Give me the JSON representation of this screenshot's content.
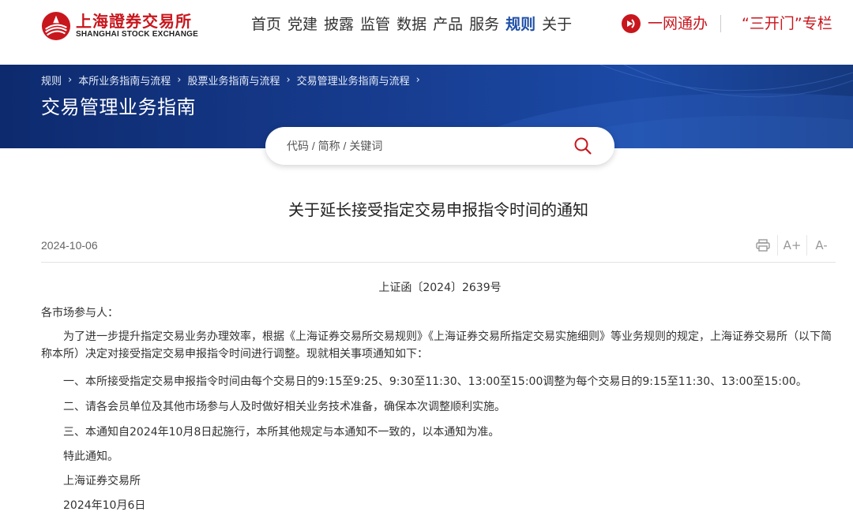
{
  "header": {
    "logo_cn": "上海證券交易所",
    "logo_en": "SHANGHAI STOCK EXCHANGE",
    "nav": [
      "首页",
      "党建",
      "披露",
      "监管",
      "数据",
      "产品",
      "服务",
      "规则",
      "关于"
    ],
    "active_nav": "规则",
    "quick_link_1": "一网通办",
    "quick_link_2": "“三开门”专栏"
  },
  "banner": {
    "breadcrumb": [
      "规则",
      "本所业务指南与流程",
      "股票业务指南与流程",
      "交易管理业务指南与流程"
    ],
    "title": "交易管理业务指南"
  },
  "search": {
    "placeholder": "代码 / 简称 / 关键词"
  },
  "article": {
    "title": "关于延长接受指定交易申报指令时间的通知",
    "date": "2024-10-06",
    "doc_number": "上证函〔2024〕2639号",
    "salutation": "各市场参与人：",
    "paragraph_1": "为了进一步提升指定交易业务办理效率，根据《上海证券交易所交易规则》《上海证券交易所指定交易实施细则》等业务规则的规定，上海证券交易所（以下简称本所）决定对接受指定交易申报指令时间进行调整。现就相关事项通知如下：",
    "item_1": "一、本所接受指定交易申报指令时间由每个交易日的9:15至9:25、9:30至11:30、13:00至15:00调整为每个交易日的9:15至11:30、13:00至15:00。",
    "item_2": "二、请各会员单位及其他市场参与人及时做好相关业务技术准备，确保本次调整顺利实施。",
    "item_3": "三、本通知自2024年10月8日起施行，本所其他规定与本通知不一致的，以本通知为准。",
    "closing": "特此通知。",
    "signature": "上海证券交易所",
    "sign_date": "2024年10月6日"
  },
  "tools": {
    "increase_font": "A+",
    "decrease_font": "A-"
  },
  "colors": {
    "brand_red": "#c8161d",
    "nav_active": "#1f4fa8",
    "banner_blue": "#173c8f"
  },
  "icons": [
    "sse-logo-icon",
    "one-network-icon",
    "search-icon",
    "print-icon",
    "chevron-right-icon"
  ]
}
